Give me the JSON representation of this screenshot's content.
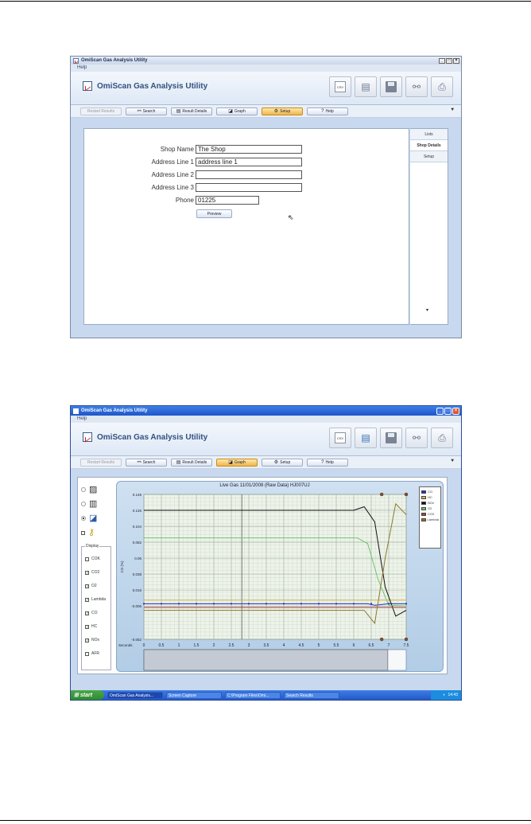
{
  "screen1": {
    "window_title": "OmiScan Gas Analysis Utility",
    "menu_help": "Help",
    "app_title": "OmiScan Gas Analysis Utility",
    "toolbar": {
      "csv_label": "CSV"
    },
    "tabs": [
      {
        "label": "Restart Results",
        "state": "disabled",
        "icon": ""
      },
      {
        "label": "Search",
        "state": "normal",
        "icon": "binoculars-icon"
      },
      {
        "label": "Result Details",
        "state": "normal",
        "icon": "details-icon"
      },
      {
        "label": "Graph",
        "state": "normal",
        "icon": "graph-icon"
      },
      {
        "label": "Setup",
        "state": "active",
        "icon": "setup-icon"
      },
      {
        "label": "Help",
        "state": "normal",
        "icon": "help-icon"
      }
    ],
    "side_tabs": [
      "Lists",
      "Shop Details",
      "Setup"
    ],
    "form": {
      "shop_name_label": "Shop Name",
      "shop_name_value": "The Shop",
      "addr1_label": "Address Line 1",
      "addr1_value": "address line 1",
      "addr2_label": "Address Line 2",
      "addr2_value": "",
      "addr3_label": "Address Line 3",
      "addr3_value": "",
      "phone_label": "Phone",
      "phone_value": "01225",
      "preview_label": "Preview"
    }
  },
  "screen2": {
    "window_title": "OmiScan Gas Analysis Utility",
    "menu_help": "Help",
    "app_title": "OmiScan Gas Analysis Utility",
    "toolbar": {
      "csv_label": "CSV"
    },
    "tabs": [
      {
        "label": "Restart Results",
        "state": "disabled"
      },
      {
        "label": "Search",
        "state": "normal"
      },
      {
        "label": "Result Details",
        "state": "normal"
      },
      {
        "label": "Graph",
        "state": "active"
      },
      {
        "label": "Setup",
        "state": "normal"
      },
      {
        "label": "Help",
        "state": "normal"
      }
    ],
    "display_label": "Display",
    "display_options": [
      {
        "label": "COK",
        "checked": false
      },
      {
        "label": "CO2",
        "checked": true
      },
      {
        "label": "O2",
        "checked": true
      },
      {
        "label": "Lambda",
        "checked": true
      },
      {
        "label": "CO",
        "checked": true
      },
      {
        "label": "HC",
        "checked": true
      },
      {
        "label": "NOx",
        "checked": true
      },
      {
        "label": "AFR",
        "checked": false
      }
    ],
    "taskbar": {
      "start": "start",
      "items": [
        "OmiScan Gas Analysis...",
        "Screen Capture",
        "C:\\Program Files\\Omi...",
        "Search Results"
      ],
      "clock": "14:43"
    }
  },
  "chart_data": {
    "type": "line",
    "title": "Live Gas 11/01/2008 (Raw Data) HJ007UJ",
    "ylabel": "CO (%)",
    "xlabel": "Seconds",
    "x_ticks": [
      "0",
      "0.5",
      "1",
      "1.5",
      "2",
      "2.5",
      "3",
      "3.5",
      "4",
      "4.5",
      "5",
      "5.5",
      "6",
      "6.5",
      "7",
      "7.5"
    ],
    "y_ticks": [
      "0.148",
      "0.126",
      "0.104",
      "0.082",
      "0.06",
      "0.038",
      "0.016",
      "-0.006",
      "-0.052"
    ],
    "ylim": [
      -0.052,
      0.148
    ],
    "xlim": [
      0,
      7.5
    ],
    "grid": true,
    "legend_placement": "right",
    "legend": [
      "CO",
      "HC",
      "NOx",
      "O2",
      "CO2",
      "Lambda"
    ],
    "series": [
      {
        "name": "CO",
        "color": "#1f2fd0",
        "x": [
          0,
          6.4,
          6.6,
          6.8,
          7.0,
          7.3,
          7.5
        ],
        "values": [
          -0.003,
          -0.003,
          -0.005,
          -0.004,
          -0.003,
          -0.003,
          -0.003
        ]
      },
      {
        "name": "HC",
        "color": "#d8b84a",
        "x": [
          0,
          6.4,
          6.6,
          7.0,
          7.5
        ],
        "values": [
          0.002,
          0.002,
          0.002,
          0.002,
          0.002
        ]
      },
      {
        "name": "NOx",
        "color": "#111111",
        "x": [
          0,
          6.0,
          6.3,
          6.6,
          6.9,
          7.2,
          7.5
        ],
        "values": [
          0.126,
          0.126,
          0.131,
          0.11,
          0.02,
          -0.02,
          -0.012
        ]
      },
      {
        "name": "O2",
        "color": "#6fc46f",
        "x": [
          0,
          6.1,
          6.4,
          6.7,
          7.0,
          7.5
        ],
        "values": [
          0.088,
          0.088,
          0.08,
          0.03,
          -0.005,
          -0.006
        ]
      },
      {
        "name": "CO2",
        "color": "#b03a3a",
        "x": [
          0,
          7.5
        ],
        "values": [
          -0.008,
          -0.008
        ]
      },
      {
        "name": "Lambda",
        "color": "#8a7a2a",
        "x": [
          0,
          6.3,
          6.6,
          6.9,
          7.2,
          7.5
        ],
        "values": [
          -0.012,
          -0.012,
          -0.03,
          0.06,
          0.135,
          0.12
        ]
      }
    ]
  }
}
